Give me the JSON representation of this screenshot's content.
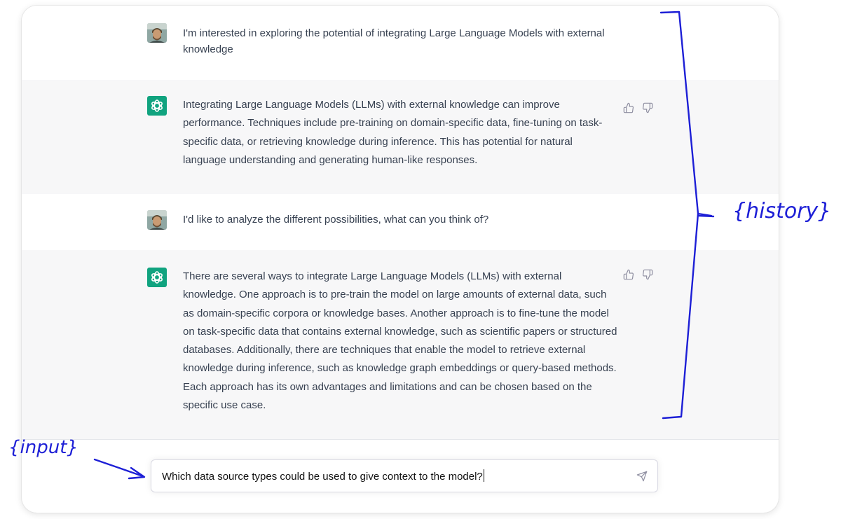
{
  "messages": [
    {
      "role": "user",
      "text": "I'm interested in exploring the potential of integrating Large Language Models with external knowledge"
    },
    {
      "role": "assistant",
      "text": "Integrating Large Language Models (LLMs) with external knowledge can improve performance. Techniques include pre-training on domain-specific data, fine-tuning on task-specific data, or retrieving knowledge during inference. This has potential for natural language understanding and generating human-like responses."
    },
    {
      "role": "user",
      "text": "I'd like to analyze the different possibilities, what can you think of?"
    },
    {
      "role": "assistant",
      "text": "There are several ways to integrate Large Language Models (LLMs) with external knowledge. One approach is to pre-train the model on large amounts of external data, such as domain-specific corpora or knowledge bases. Another approach is to fine-tune the model on task-specific data that contains external knowledge, such as scientific papers or structured databases. Additionally, there are techniques that enable the model to retrieve external knowledge during inference, such as knowledge graph embeddings or query-based methods. Each approach has its own advantages and limitations and can be chosen based on the specific use case."
    }
  ],
  "composer": {
    "value": "Which data source types could be used to give context to the model?"
  },
  "annotations": {
    "history_label": "{history}",
    "input_label": "{input}"
  },
  "colors": {
    "assistant_bg": "#f7f7f8",
    "brand_green": "#10a37f",
    "annotation_blue": "#1d1fd6"
  },
  "icons": {
    "user_avatar": "user-photo-avatar",
    "assistant_avatar": "openai-logo-icon",
    "feedback": [
      "thumbs-up-icon",
      "thumbs-down-icon"
    ],
    "send": "paper-plane-icon"
  }
}
